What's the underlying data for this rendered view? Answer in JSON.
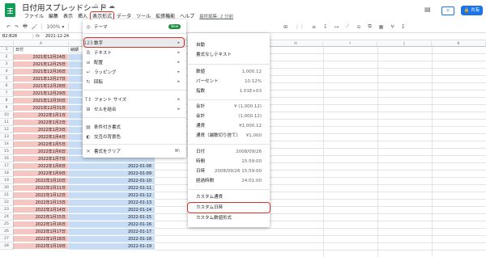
{
  "header": {
    "title": "日付用スプレッドシート",
    "icons": [
      "star-icon",
      "move-folder-icon",
      "cloud-status-icon"
    ],
    "menu": [
      "ファイル",
      "編集",
      "表示",
      "挿入",
      "表示形式",
      "データ",
      "ツール",
      "拡張機能",
      "ヘルプ"
    ],
    "active_menu_index": 4,
    "last_edit": "最終編集: 2 分前",
    "share_label": "共有",
    "present_label": "＋"
  },
  "toolbar": {
    "zoom": "100%",
    "items": [
      "↶",
      "↷",
      "🖶",
      "🖌"
    ],
    "right_items": [
      "⊞",
      "⋮⋮",
      "≡",
      "↧",
      "↦",
      "⟋",
      "⊝",
      "⧉",
      "▦",
      "ⵖ",
      "Σ"
    ],
    "font_glyph": "A"
  },
  "formula": {
    "namebox": "B2:B28",
    "fx": "fx",
    "value": "2021-12-24"
  },
  "columns": {
    "A": "A",
    "B": "B",
    "H": "H",
    "I": "I",
    "J": "J",
    "K": "K"
  },
  "rows": [
    {
      "n": "1",
      "a": "日付",
      "b": "納期"
    },
    {
      "n": "2",
      "a": "2021年12月24日",
      "b": ""
    },
    {
      "n": "3",
      "a": "2021年12月25日",
      "b": ""
    },
    {
      "n": "4",
      "a": "2021年12月26日",
      "b": ""
    },
    {
      "n": "5",
      "a": "2021年12月27日",
      "b": ""
    },
    {
      "n": "6",
      "a": "2021年12月28日",
      "b": ""
    },
    {
      "n": "7",
      "a": "2021年12月29日",
      "b": ""
    },
    {
      "n": "8",
      "a": "2021年12月30日",
      "b": ""
    },
    {
      "n": "9",
      "a": "2021年12月31日",
      "b": ""
    },
    {
      "n": "10",
      "a": "2022年1月1日",
      "b": ""
    },
    {
      "n": "11",
      "a": "2022年1月2日",
      "b": ""
    },
    {
      "n": "12",
      "a": "2022年1月3日",
      "b": ""
    },
    {
      "n": "13",
      "a": "2022年1月4日",
      "b": ""
    },
    {
      "n": "14",
      "a": "2022年1月5日",
      "b": ""
    },
    {
      "n": "15",
      "a": "2022年1月6日",
      "b": ""
    },
    {
      "n": "16",
      "a": "2022年1月7日",
      "b": ""
    },
    {
      "n": "17",
      "a": "2022年1月8日",
      "b": "2022-01-08"
    },
    {
      "n": "18",
      "a": "2022年1月9日",
      "b": "2022-01-09"
    },
    {
      "n": "19",
      "a": "2022年1月10日",
      "b": "2022-01-10"
    },
    {
      "n": "20",
      "a": "2022年1月11日",
      "b": "2022-01-11"
    },
    {
      "n": "21",
      "a": "2022年1月12日",
      "b": "2022-01-12"
    },
    {
      "n": "22",
      "a": "2022年1月13日",
      "b": "2022-01-13"
    },
    {
      "n": "23",
      "a": "2022年1月14日",
      "b": "2022-01-14"
    },
    {
      "n": "24",
      "a": "2022年1月15日",
      "b": "2022-01-15"
    },
    {
      "n": "25",
      "a": "2022年1月16日",
      "b": "2022-01-16"
    },
    {
      "n": "26",
      "a": "2022年1月17日",
      "b": "2022-01-17"
    },
    {
      "n": "27",
      "a": "2022年1月18日",
      "b": "2022-01-18"
    },
    {
      "n": "28",
      "a": "2022年1月19日",
      "b": "2022-01-19"
    }
  ],
  "format_menu": {
    "items": [
      {
        "icon": "◎",
        "label": "テーマ",
        "badge": "New"
      },
      {
        "icon": "123",
        "label": "数字",
        "arrow": "▸"
      },
      {
        "icon": "B",
        "label": "テキスト",
        "arrow": "▸"
      },
      {
        "icon": "≡",
        "label": "配置",
        "arrow": "▸"
      },
      {
        "icon": "↵",
        "label": "ラッピング",
        "arrow": "▸"
      },
      {
        "icon": "↻",
        "label": "回転",
        "arrow": "▸"
      },
      {
        "icon": "T↕",
        "label": "フォント サイズ",
        "arrow": "▸"
      },
      {
        "icon": "⊞",
        "label": "セルを結合",
        "arrow": "▸"
      },
      {
        "icon": "▤",
        "label": "条件付き書式"
      },
      {
        "icon": "◐",
        "label": "交互の背景色"
      },
      {
        "icon": "✕",
        "label": "書式をクリア",
        "shortcut": "⌘\\"
      }
    ]
  },
  "number_submenu": {
    "items": [
      {
        "label": "自動",
        "example": ""
      },
      {
        "label": "書式なしテキスト",
        "example": ""
      },
      {
        "label": "数値",
        "example": "1,000.12"
      },
      {
        "label": "パーセント",
        "example": "10.12%"
      },
      {
        "label": "指数",
        "example": "1.01E+03"
      },
      {
        "label": "会計",
        "example": "¥ (1,000.12)"
      },
      {
        "label": "会計",
        "example": "(1,000.12)"
      },
      {
        "label": "通貨",
        "example": "¥1,000.12"
      },
      {
        "label": "通貨（端数切り捨て）",
        "example": "¥1,000"
      },
      {
        "label": "日付",
        "example": "2008/09/26"
      },
      {
        "label": "時間",
        "example": "15:59:00"
      },
      {
        "label": "日時",
        "example": "2008/09/26 15:59:00"
      },
      {
        "label": "経過時間",
        "example": "24:01:00"
      },
      {
        "label": "カスタム通貨",
        "example": ""
      },
      {
        "label": "カスタム日時",
        "example": ""
      },
      {
        "label": "カスタム数値形式",
        "example": ""
      }
    ]
  },
  "colors": {
    "accent": "#1a73e8",
    "highlight_red": "#d93025",
    "date_fill": "#f4c7c3",
    "selection_fill": "#c6dbf4",
    "logo": "#0f9d58"
  }
}
